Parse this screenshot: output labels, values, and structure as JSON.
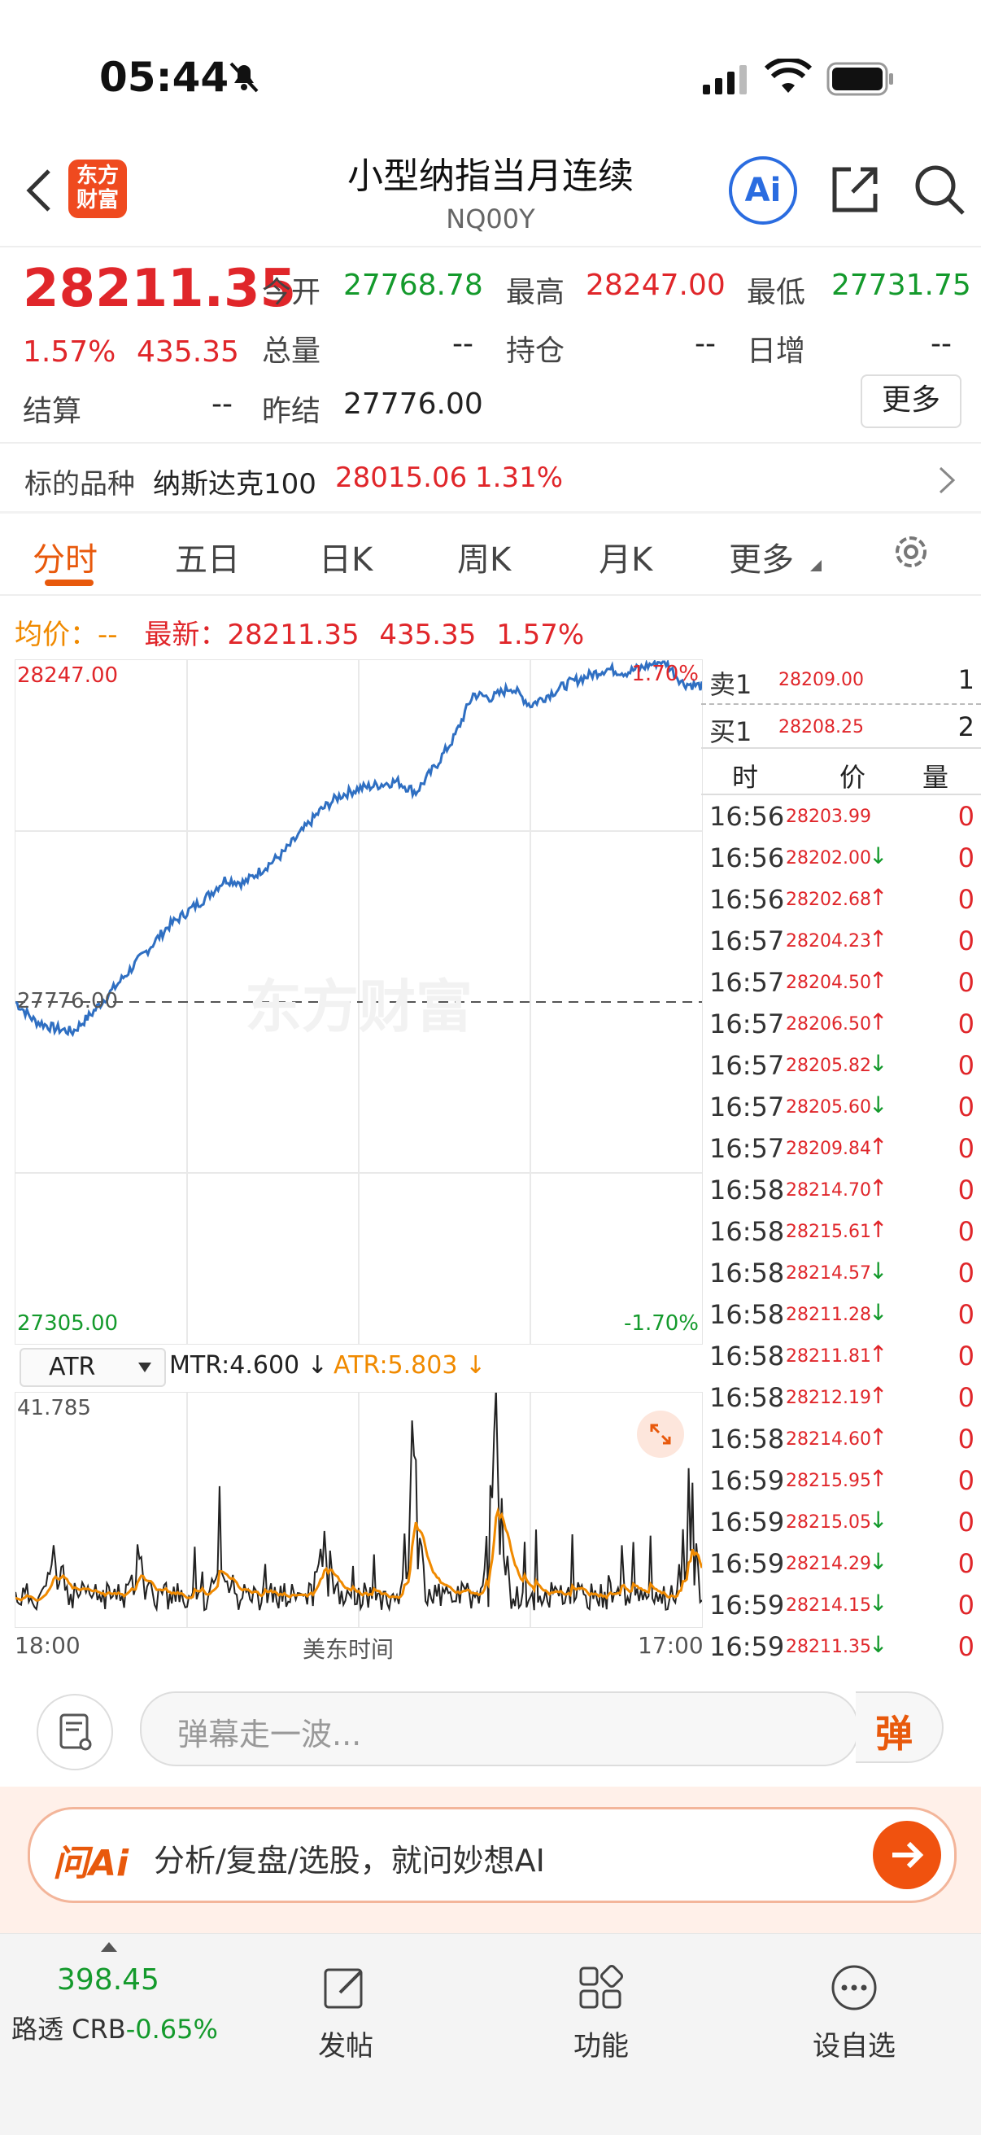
{
  "status": {
    "time": "05:44"
  },
  "header": {
    "back_icon": "chevron-left-icon",
    "logo_line1": "东方",
    "logo_line2": "财富",
    "title": "小型纳指当月连续",
    "subtitle": "NQ00Y",
    "ai_label": "Ai"
  },
  "quote": {
    "price": "28211.35",
    "change_pct": "1.57%",
    "change": "435.35",
    "open_label": "今开",
    "open": "27768.78",
    "high_label": "最高",
    "high": "28247.00",
    "low_label": "最低",
    "low": "27731.75",
    "volume_label": "总量",
    "volume": "--",
    "oi_label": "持仓",
    "oi": "--",
    "daily_inc_label": "日增",
    "daily_inc": "--",
    "settle_label": "结算",
    "settle": "--",
    "prev_settle_label": "昨结",
    "prev_settle": "27776.00",
    "more_label": "更多"
  },
  "underlying": {
    "label": "标的品种",
    "name": "纳斯达克100",
    "price": "28015.06",
    "pct": "1.31%"
  },
  "tabs": [
    "分时",
    "五日",
    "日K",
    "周K",
    "月K",
    "更多"
  ],
  "infoline": {
    "avg_label": "均价：--",
    "latest_label": "最新：",
    "latest": "28211.35",
    "change": "435.35",
    "pct": "1.57%"
  },
  "chart_data": {
    "type": "line",
    "y_top_label": "28247.00",
    "y_mid_label": "27776.00",
    "y_bottom_label": "27305.00",
    "pct_top": "1.70%",
    "pct_bottom": "-1.70%",
    "ylim": [
      27305,
      28247
    ],
    "x_start": "18:00",
    "x_mid": "美东时间",
    "x_end": "17:00",
    "watermark": "东方财富",
    "values": [
      27776,
      27750,
      27740,
      27735,
      27760,
      27790,
      27820,
      27850,
      27880,
      27900,
      27920,
      27945,
      27940,
      27960,
      27980,
      28010,
      28040,
      28060,
      28070,
      28075,
      28080,
      28065,
      28100,
      28140,
      28200,
      28195,
      28210,
      28185,
      28200,
      28215,
      28225,
      28235,
      28230,
      28238,
      28247,
      28215,
      28211
    ]
  },
  "atr": {
    "selector": "ATR",
    "mtr_label": "MTR:4.600",
    "atr_label": "ATR:5.803",
    "y_max_label": "41.785",
    "ylim": [
      0,
      41.785
    ]
  },
  "orderbook": {
    "sell_label": "卖1",
    "sell_price": "28209.00",
    "sell_qty": "1",
    "buy_label": "买1",
    "buy_price": "28208.25",
    "buy_qty": "2"
  },
  "trades_header": [
    "时",
    "价",
    "量"
  ],
  "trades": [
    {
      "t": "16:56",
      "p": "28203.99",
      "d": "",
      "v": "0"
    },
    {
      "t": "16:56",
      "p": "28202.00",
      "d": "↓",
      "v": "0"
    },
    {
      "t": "16:56",
      "p": "28202.68",
      "d": "↑",
      "v": "0"
    },
    {
      "t": "16:57",
      "p": "28204.23",
      "d": "↑",
      "v": "0"
    },
    {
      "t": "16:57",
      "p": "28204.50",
      "d": "↑",
      "v": "0"
    },
    {
      "t": "16:57",
      "p": "28206.50",
      "d": "↑",
      "v": "0"
    },
    {
      "t": "16:57",
      "p": "28205.82",
      "d": "↓",
      "v": "0"
    },
    {
      "t": "16:57",
      "p": "28205.60",
      "d": "↓",
      "v": "0"
    },
    {
      "t": "16:57",
      "p": "28209.84",
      "d": "↑",
      "v": "0"
    },
    {
      "t": "16:58",
      "p": "28214.70",
      "d": "↑",
      "v": "0"
    },
    {
      "t": "16:58",
      "p": "28215.61",
      "d": "↑",
      "v": "0"
    },
    {
      "t": "16:58",
      "p": "28214.57",
      "d": "↓",
      "v": "0"
    },
    {
      "t": "16:58",
      "p": "28211.28",
      "d": "↓",
      "v": "0"
    },
    {
      "t": "16:58",
      "p": "28211.81",
      "d": "↑",
      "v": "0"
    },
    {
      "t": "16:58",
      "p": "28212.19",
      "d": "↑",
      "v": "0"
    },
    {
      "t": "16:58",
      "p": "28214.60",
      "d": "↑",
      "v": "0"
    },
    {
      "t": "16:59",
      "p": "28215.95",
      "d": "↑",
      "v": "0"
    },
    {
      "t": "16:59",
      "p": "28215.05",
      "d": "↓",
      "v": "0"
    },
    {
      "t": "16:59",
      "p": "28214.29",
      "d": "↓",
      "v": "0"
    },
    {
      "t": "16:59",
      "p": "28214.15",
      "d": "↓",
      "v": "0"
    },
    {
      "t": "16:59",
      "p": "28211.35",
      "d": "↓",
      "v": "0"
    }
  ],
  "comment": {
    "placeholder": "弹幕走一波...",
    "danmu_label": "弹"
  },
  "ai": {
    "logo": "问Ai",
    "prompt": "分析/复盘/选股，就问妙想AI"
  },
  "bottom_nav": {
    "index_value": "398.45",
    "index_label": "路透 CRB",
    "index_pct": "-0.65%",
    "post_label": "发帖",
    "func_label": "功能",
    "watch_label": "设自选"
  },
  "colors": {
    "up": "#e0262a",
    "down": "#149a2c",
    "accent": "#e8590c",
    "line": "#2f6fc2",
    "atr": "#f08a00"
  }
}
